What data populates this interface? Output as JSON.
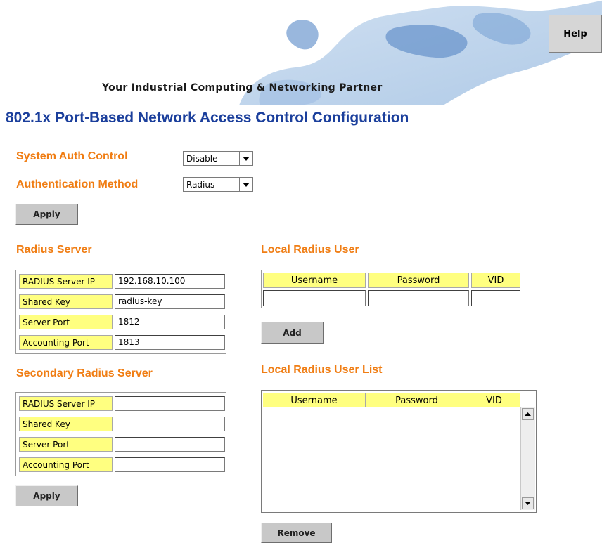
{
  "header": {
    "tagline": "Your Industrial Computing & Networking Partner",
    "help_label": "Help"
  },
  "page_title": "802.1x Port-Based Network Access Control Configuration",
  "auth": {
    "system_auth_control_label": "System Auth Control",
    "system_auth_control_value": "Disable",
    "auth_method_label": "Authentication Method",
    "auth_method_value": "Radius",
    "apply_label": "Apply"
  },
  "radius_server": {
    "title": "Radius Server",
    "rows": [
      {
        "label": "RADIUS Server IP",
        "value": "192.168.10.100"
      },
      {
        "label": "Shared Key",
        "value": "radius-key"
      },
      {
        "label": "Server Port",
        "value": "1812"
      },
      {
        "label": "Accounting Port",
        "value": "1813"
      }
    ]
  },
  "secondary_radius_server": {
    "title": "Secondary Radius Server",
    "rows": [
      {
        "label": "RADIUS Server IP",
        "value": ""
      },
      {
        "label": "Shared Key",
        "value": ""
      },
      {
        "label": "Server Port",
        "value": ""
      },
      {
        "label": "Accounting Port",
        "value": ""
      }
    ],
    "apply_label": "Apply"
  },
  "local_radius_user": {
    "title": "Local Radius User",
    "columns": [
      "Username",
      "Password",
      "VID"
    ],
    "add_label": "Add"
  },
  "local_radius_user_list": {
    "title": "Local Radius User List",
    "columns": [
      "Username",
      "Password",
      "VID"
    ],
    "rows": [],
    "remove_label": "Remove"
  },
  "colors": {
    "title_blue": "#1b3f9c",
    "section_orange": "#f07d13",
    "label_yellow": "#ffff80",
    "button_gray": "#c8c8c8"
  },
  "icons": [
    "dropdown-arrow-icon",
    "scroll-up-arrow-icon",
    "scroll-down-arrow-icon"
  ]
}
